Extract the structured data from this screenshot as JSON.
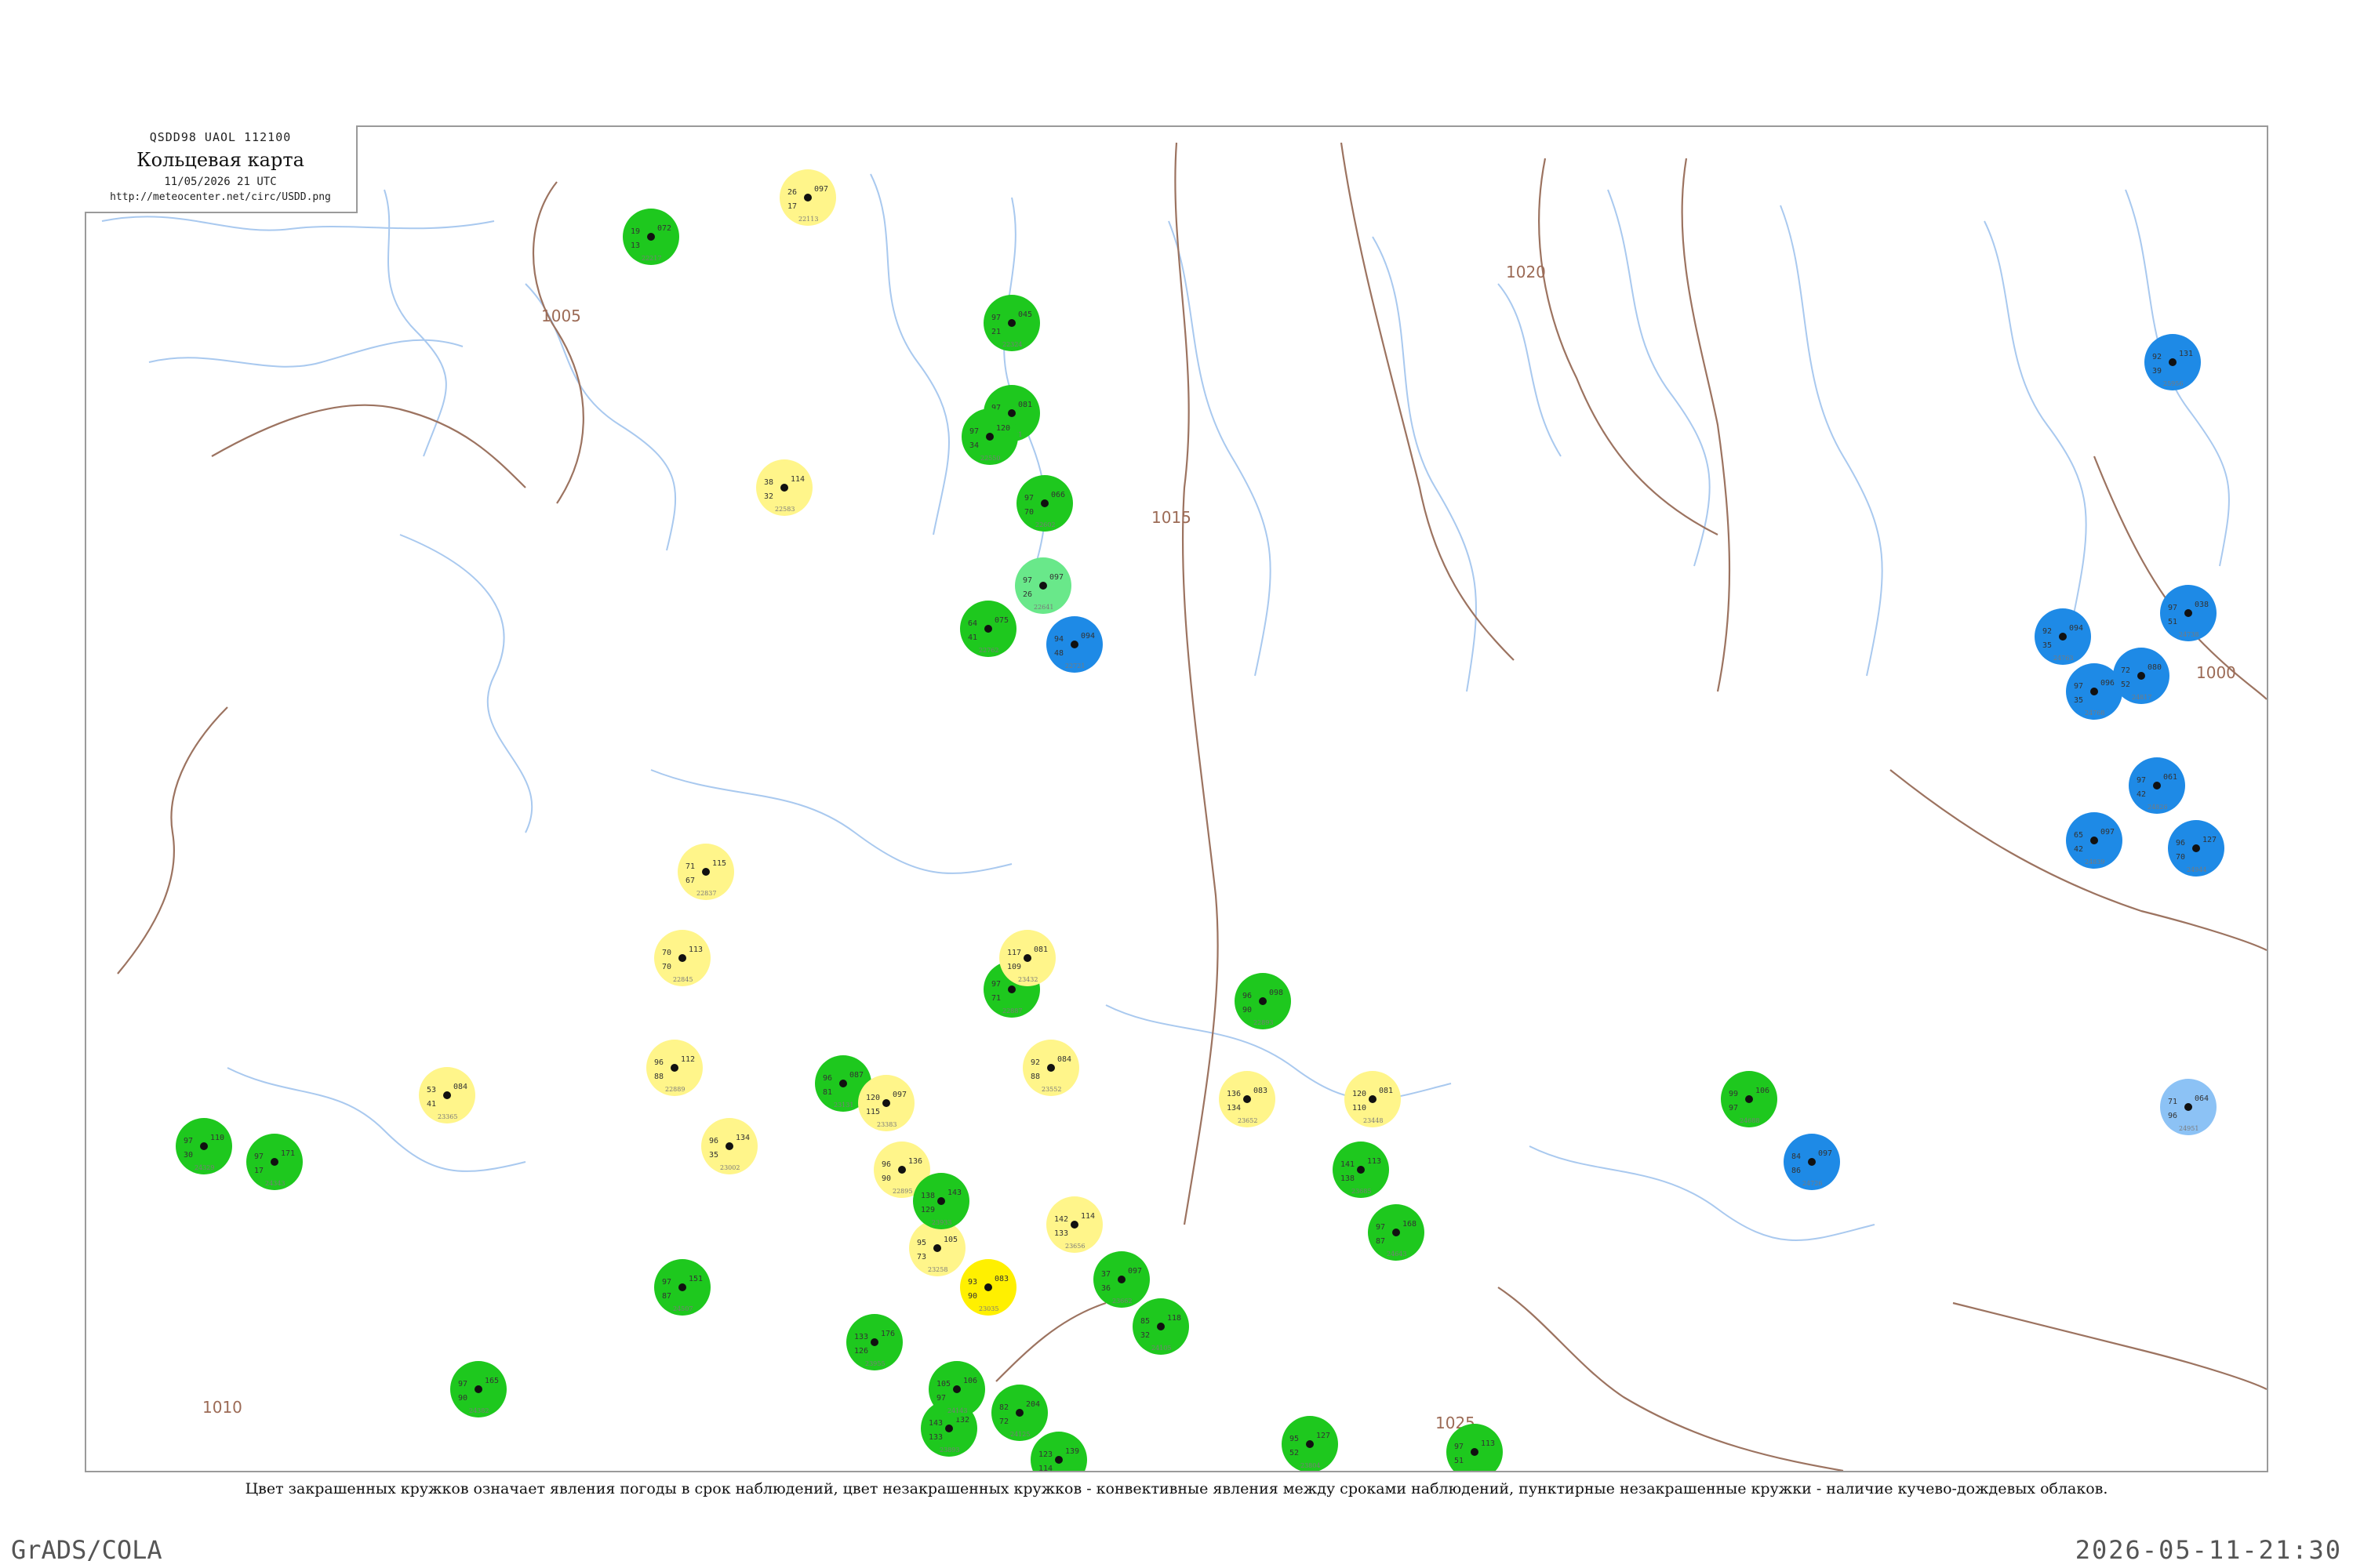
{
  "header": {
    "code": "QSDD98  UAOL  112100",
    "title": "Кольцевая карта",
    "datetime": "11/05/2026 21 UTC",
    "url": "http://meteocenter.net/circ/USDD.png"
  },
  "caption": "Цвет закрашенных кружков означает явления погоды в срок наблюдений, цвет незакрашенных кружков - конвективные явления между сроками наблюдений, пунктирные незакрашенные кружки - наличие кучево-дождевых облаков.",
  "footer": {
    "left": "GrADS/COLA",
    "right": "2026-05-11-21:30"
  },
  "colors": {
    "isobar": "#9c7360",
    "river": "#a9c9ef",
    "rain": "#1ec81e",
    "showers": "#69e88a",
    "snow": "#1e8ae6",
    "light_snow": "#8cc2f5",
    "haze": "#fff58a",
    "fog": "#fff000"
  },
  "isobar_labels": [
    "1000",
    "1005",
    "1010",
    "1015",
    "1020",
    "1025"
  ],
  "stations": [
    {
      "num": "22113",
      "val": "097",
      "temp": "26",
      "dew": "17",
      "fill": "haze"
    },
    {
      "num": "22217",
      "val": "072",
      "temp": "19",
      "dew": "13",
      "fill": "rain"
    },
    {
      "num": "22324",
      "val": "045",
      "temp": "97",
      "dew": "21",
      "fill": "rain"
    },
    {
      "num": "22471",
      "val": "081",
      "temp": "97",
      "dew": "35",
      "fill": "rain"
    },
    {
      "num": "22550",
      "val": "120",
      "temp": "97",
      "dew": "34",
      "fill": "rain"
    },
    {
      "num": "22583",
      "val": "114",
      "temp": "38",
      "dew": "32",
      "fill": "haze"
    },
    {
      "num": "22602",
      "val": "066",
      "temp": "97",
      "dew": "70",
      "fill": "rain"
    },
    {
      "num": "22641",
      "val": "097",
      "temp": "97",
      "dew": "26",
      "fill": "showers"
    },
    {
      "num": "22721",
      "val": "094",
      "temp": "94",
      "dew": "48",
      "fill": "snow"
    },
    {
      "num": "22762",
      "val": "075",
      "temp": "64",
      "dew": "41",
      "fill": "rain"
    },
    {
      "num": "22837",
      "val": "115",
      "temp": "71",
      "dew": "67",
      "fill": "haze"
    },
    {
      "num": "22845",
      "val": "113",
      "temp": "70",
      "dew": "70",
      "fill": "haze"
    },
    {
      "num": "22887",
      "val": "101",
      "temp": "97",
      "dew": "71",
      "fill": "rain"
    },
    {
      "num": "22889",
      "val": "112",
      "temp": "96",
      "dew": "88",
      "fill": "haze"
    },
    {
      "num": "22893",
      "val": "098",
      "temp": "96",
      "dew": "90",
      "fill": "rain"
    },
    {
      "num": "22895",
      "val": "136",
      "temp": "96",
      "dew": "90",
      "fill": "haze"
    },
    {
      "num": "23002",
      "val": "134",
      "temp": "96",
      "dew": "35",
      "fill": "haze"
    },
    {
      "num": "23035",
      "val": "083",
      "temp": "93",
      "dew": "90",
      "fill": "fog"
    },
    {
      "num": "23131",
      "val": "087",
      "temp": "96",
      "dew": "81",
      "fill": "rain"
    },
    {
      "num": "23258",
      "val": "105",
      "temp": "95",
      "dew": "73",
      "fill": "haze"
    },
    {
      "num": "23365",
      "val": "084",
      "temp": "53",
      "dew": "41",
      "fill": "haze"
    },
    {
      "num": "23383",
      "val": "097",
      "temp": "120",
      "dew": "115",
      "fill": "haze"
    },
    {
      "num": "23432",
      "val": "081",
      "temp": "117",
      "dew": "109",
      "fill": "haze"
    },
    {
      "num": "23448",
      "val": "081",
      "temp": "120",
      "dew": "110",
      "fill": "haze"
    },
    {
      "num": "23552",
      "val": "084",
      "temp": "92",
      "dew": "88",
      "fill": "haze"
    },
    {
      "num": "23652",
      "val": "083",
      "temp": "136",
      "dew": "134",
      "fill": "haze"
    },
    {
      "num": "23656",
      "val": "114",
      "temp": "142",
      "dew": "133",
      "fill": "haze"
    },
    {
      "num": "23662",
      "val": "097",
      "temp": "37",
      "dew": "36",
      "fill": "rain"
    },
    {
      "num": "23685",
      "val": "113",
      "temp": "141",
      "dew": "138",
      "fill": "rain"
    },
    {
      "num": "23804",
      "val": "127",
      "temp": "95",
      "dew": "52",
      "fill": "rain"
    },
    {
      "num": "23849",
      "val": "139",
      "temp": "123",
      "dew": "114",
      "fill": "rain"
    },
    {
      "num": "23893",
      "val": "132",
      "temp": "143",
      "dew": "133",
      "fill": "rain"
    },
    {
      "num": "23933",
      "val": "143",
      "temp": "138",
      "dew": "129",
      "fill": "rain"
    },
    {
      "num": "23955",
      "val": "176",
      "temp": "133",
      "dew": "126",
      "fill": "rain"
    },
    {
      "num": "24105",
      "val": "118",
      "temp": "85",
      "dew": "32",
      "fill": "rain"
    },
    {
      "num": "24125",
      "val": "204",
      "temp": "82",
      "dew": "72",
      "fill": "rain"
    },
    {
      "num": "24143",
      "val": "106",
      "temp": "105",
      "dew": "97",
      "fill": "rain"
    },
    {
      "num": "24266",
      "val": "113",
      "temp": "97",
      "dew": "51",
      "fill": "rain"
    },
    {
      "num": "24329",
      "val": "110",
      "temp": "97",
      "dew": "30",
      "fill": "rain"
    },
    {
      "num": "24343",
      "val": "171",
      "temp": "97",
      "dew": "17",
      "fill": "rain"
    },
    {
      "num": "24382",
      "val": "165",
      "temp": "97",
      "dew": "90",
      "fill": "rain"
    },
    {
      "num": "24507",
      "val": "151",
      "temp": "97",
      "dew": "87",
      "fill": "rain"
    },
    {
      "num": "24643",
      "val": "168",
      "temp": "97",
      "dew": "87",
      "fill": "rain"
    },
    {
      "num": "24688",
      "val": "106",
      "temp": "99",
      "dew": "97",
      "fill": "rain"
    },
    {
      "num": "24726",
      "val": "097",
      "temp": "84",
      "dew": "86",
      "fill": "snow"
    },
    {
      "num": "24738",
      "val": "038",
      "temp": "97",
      "dew": "51",
      "fill": "snow"
    },
    {
      "num": "24763",
      "val": "094",
      "temp": "92",
      "dew": "35",
      "fill": "snow"
    },
    {
      "num": "24768",
      "val": "096",
      "temp": "97",
      "dew": "35",
      "fill": "snow"
    },
    {
      "num": "24817",
      "val": "080",
      "temp": "72",
      "dew": "52",
      "fill": "snow"
    },
    {
      "num": "24826",
      "val": "061",
      "temp": "97",
      "dew": "42",
      "fill": "snow"
    },
    {
      "num": "24839",
      "val": "097",
      "temp": "65",
      "dew": "42",
      "fill": "snow"
    },
    {
      "num": "24944",
      "val": "127",
      "temp": "96",
      "dew": "70",
      "fill": "snow"
    },
    {
      "num": "24951",
      "val": "064",
      "temp": "71",
      "dew": "96",
      "fill": "light_snow"
    },
    {
      "num": "25956",
      "val": "131",
      "temp": "92",
      "dew": "39",
      "fill": "snow"
    }
  ]
}
